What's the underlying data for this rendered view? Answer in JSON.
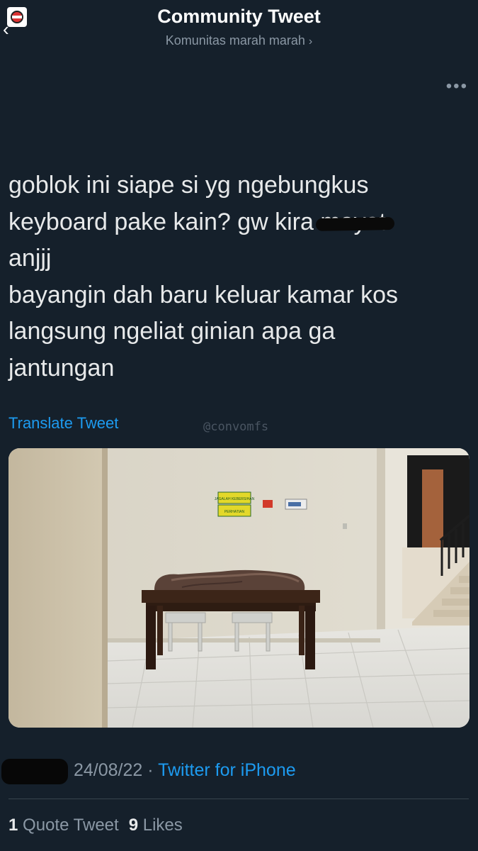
{
  "header": {
    "title": "Community Tweet",
    "community": "Komunitas marah marah",
    "community_chevron": "›",
    "back_icon": "arrow-left",
    "more_icon": "ellipsis"
  },
  "tweet": {
    "line1": "goblok ini siape si yg ngebungkus",
    "line2_before": "keyboard pake kain? gw kira ",
    "line2_struck": "mayat",
    "line3": "anjjj",
    "line4": "bayangin dah baru keluar kamar kos",
    "line5": "langsung ngeliat ginian apa ga",
    "line6": "jantungan"
  },
  "translate_label": "Translate Tweet",
  "watermark": "@convomfs",
  "photo_signs": {
    "sign_top": "JAGALAH KEBERSIHAN",
    "sign_bottom": "PERHATIAN"
  },
  "meta": {
    "date": "24/08/22",
    "separator": " · ",
    "source": "Twitter for iPhone"
  },
  "stats": {
    "quotes_count": "1",
    "quotes_label": "Quote Tweet",
    "likes_count": "9",
    "likes_label": "Likes"
  },
  "colors": {
    "background": "#15202b",
    "accent": "#1d9bf0",
    "secondary_text": "#8b98a5"
  }
}
